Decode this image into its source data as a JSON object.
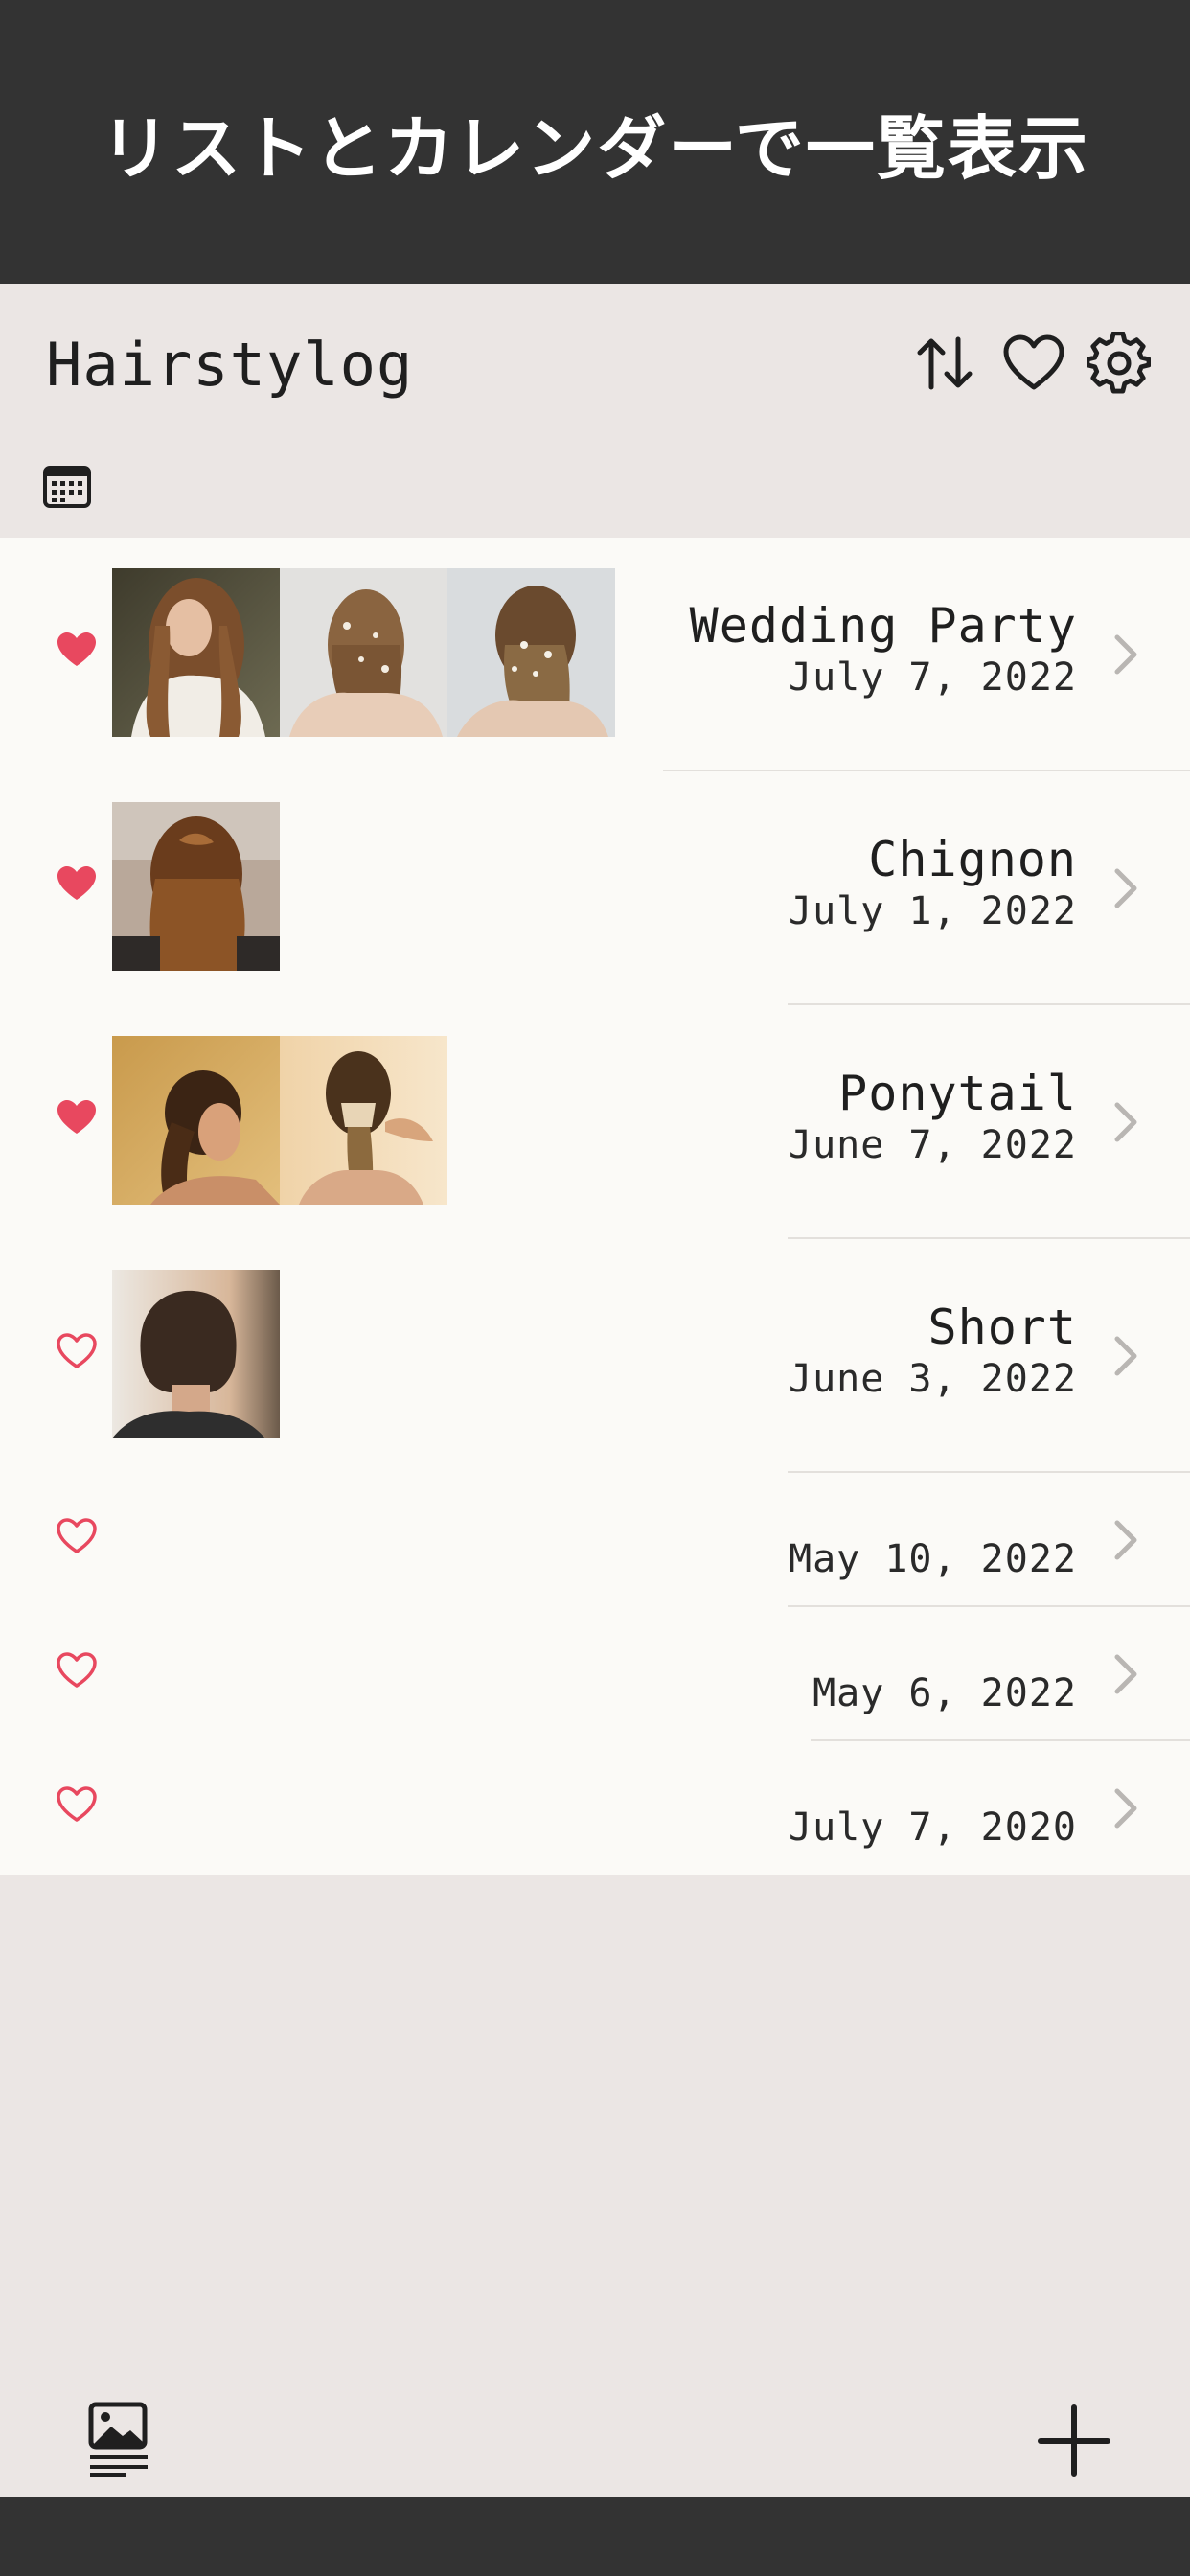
{
  "banner": {
    "title": "リストとカレンダーで一覧表示"
  },
  "app": {
    "title": "Hairstylog"
  },
  "toolbar": {
    "sort_icon": "sort-arrows-icon",
    "favorites_icon": "heart-outline-icon",
    "settings_icon": "gear-icon",
    "calendar_icon": "calendar-icon"
  },
  "colors": {
    "heart_filled": "#e8485f",
    "heart_outline": "#e8485f",
    "chevron": "#b9b6b3",
    "banner_bg": "#333333",
    "screen_bg": "#ebe6e4",
    "list_bg": "#fbfaf7"
  },
  "entries": [
    {
      "name": "Wedding Party",
      "date": "July 7, 2022",
      "favorite": true,
      "photos": 3
    },
    {
      "name": "Chignon",
      "date": "July 1, 2022",
      "favorite": true,
      "photos": 1
    },
    {
      "name": "Ponytail",
      "date": "June 7, 2022",
      "favorite": true,
      "photos": 2
    },
    {
      "name": "Short",
      "date": "June 3, 2022",
      "favorite": false,
      "photos": 1
    },
    {
      "name": "",
      "date": "May 10, 2022",
      "favorite": false,
      "photos": 0
    },
    {
      "name": "",
      "date": "May 6, 2022",
      "favorite": false,
      "photos": 0
    },
    {
      "name": "",
      "date": "July 7, 2020",
      "favorite": false,
      "photos": 0
    }
  ],
  "bottom": {
    "gallery_icon": "photo-list-icon",
    "add_icon": "plus-icon"
  }
}
